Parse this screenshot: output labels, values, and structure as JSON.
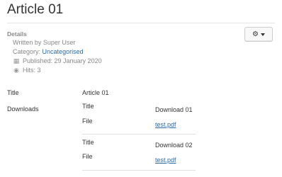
{
  "article": {
    "title": "Article 01"
  },
  "details": {
    "heading": "Details",
    "written_by": "Written by Super User",
    "category_prefix": "Category:",
    "category_link": "Uncategorised",
    "published": "Published: 29 January 2020",
    "hits": "Hits: 3"
  },
  "fields": {
    "title_label": "Title",
    "title_value": "Article 01",
    "downloads_label": "Downloads"
  },
  "downloads": [
    {
      "title_label": "Title",
      "title_value": "Download 01",
      "file_label": "File",
      "file_value": "test.pdf"
    },
    {
      "title_label": "Title",
      "title_value": "Download 02",
      "file_label": "File",
      "file_value": "test.pdf"
    }
  ],
  "icons": {
    "gear": "gear-icon",
    "calendar": "calendar-icon",
    "eye": "eye-icon",
    "caret": "chevron-down-icon"
  },
  "colors": {
    "link": "#2a6aa6",
    "muted": "#888888"
  }
}
